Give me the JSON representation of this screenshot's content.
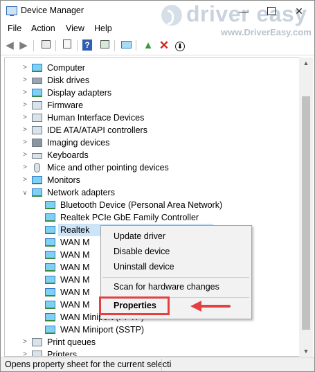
{
  "window": {
    "title": "Device Manager",
    "minimize_glyph": "—",
    "close_glyph": "✕"
  },
  "watermark": {
    "brand": "driver easy",
    "url": "www.DriverEasy.com"
  },
  "menu": [
    "File",
    "Action",
    "View",
    "Help"
  ],
  "toolbar_icons": [
    "back-arrow-icon",
    "forward-arrow-icon",
    "properties-pane-icon",
    "help-book-icon",
    "help-icon",
    "show-hide-icon",
    "scan-monitor-icon",
    "update-driver-icon",
    "uninstall-icon",
    "download-driver-icon"
  ],
  "tree": {
    "categories": [
      {
        "label": "Computer",
        "icon": "computer-icon"
      },
      {
        "label": "Disk drives",
        "icon": "disk-drive-icon"
      },
      {
        "label": "Display adapters",
        "icon": "display-adapter-icon"
      },
      {
        "label": "Firmware",
        "icon": "firmware-icon"
      },
      {
        "label": "Human Interface Devices",
        "icon": "hid-icon"
      },
      {
        "label": "IDE ATA/ATAPI controllers",
        "icon": "ide-controller-icon"
      },
      {
        "label": "Imaging devices",
        "icon": "camera-icon"
      },
      {
        "label": "Keyboards",
        "icon": "keyboard-icon"
      },
      {
        "label": "Mice and other pointing devices",
        "icon": "mouse-icon"
      },
      {
        "label": "Monitors",
        "icon": "monitor-icon"
      },
      {
        "label": "Network adapters",
        "icon": "network-adapter-icon"
      }
    ],
    "network_children": [
      "Bluetooth Device (Personal Area Network)",
      "Realtek PCIe GbE Family Controller",
      "Realtek",
      "WAN M",
      "WAN M",
      "WAN M",
      "WAN M",
      "WAN M",
      "WAN M",
      "WAN Miniport (PPTP)",
      "WAN Miniport (SSTP)"
    ],
    "after": [
      {
        "label": "Print queues",
        "icon": "printer-icon"
      },
      {
        "label": "Printers",
        "icon": "printer-icon"
      }
    ]
  },
  "context_menu": {
    "update": "Update driver",
    "disable": "Disable device",
    "uninstall": "Uninstall device",
    "scan": "Scan for hardware changes",
    "properties": "Properties"
  },
  "status": "Opens property sheet for the current selecti",
  "colors": {
    "highlight_red": "#e34141",
    "selection_blue": "#cce4f7"
  }
}
